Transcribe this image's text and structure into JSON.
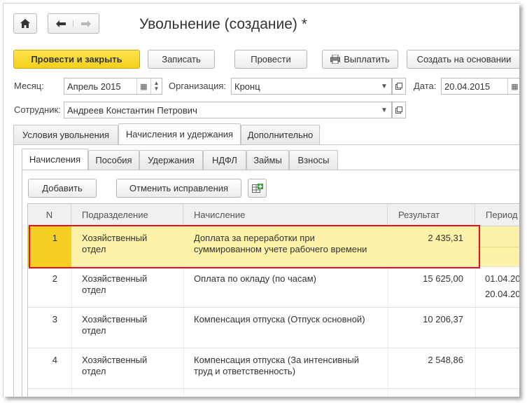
{
  "window": {
    "title": "Увольнение (создание) *"
  },
  "nav": {
    "home_icon": "home-icon",
    "back_icon": "arrow-left-icon",
    "forward_icon": "arrow-right-icon"
  },
  "toolbar": {
    "post_close": "Провести и закрыть",
    "save": "Записать",
    "post": "Провести",
    "pay": "Выплатить",
    "create_based": "Создать на основании"
  },
  "form": {
    "month_label": "Месяц:",
    "month_value": "Апрель 2015",
    "org_label": "Организация:",
    "org_value": "Кронц",
    "date_label": "Дата:",
    "date_value": "20.04.2015",
    "employee_label": "Сотрудник:",
    "employee_value": "Андреев Константин Петрович"
  },
  "tabs": [
    "Условия увольнения",
    "Начисления и удержания",
    "Дополнительно"
  ],
  "subtabs": [
    "Начисления",
    "Пособия",
    "Удержания",
    "НДФЛ",
    "Займы",
    "Взносы"
  ],
  "actions": {
    "add": "Добавить",
    "cancel_fix": "Отменить исправления"
  },
  "table": {
    "columns": [
      "N",
      "Подразделение",
      "Начисление",
      "Результат",
      "Период"
    ],
    "rows": [
      {
        "n": "1",
        "dept1": "Хозяйственный",
        "dept2": "отдел",
        "acc1": "Доплата за переработки при",
        "acc2": "суммированном учете рабочего времени",
        "result": "2 435,31",
        "p1": "",
        "p2": ""
      },
      {
        "n": "2",
        "dept1": "Хозяйственный",
        "dept2": "отдел",
        "acc1": "Оплата по окладу (по часам)",
        "acc2": "",
        "result": "15 625,00",
        "p1": "01.04.20",
        "p2": "20.04.20"
      },
      {
        "n": "3",
        "dept1": "Хозяйственный",
        "dept2": "отдел",
        "acc1": "Компенсация отпуска (Отпуск основной)",
        "acc2": "",
        "result": "10 206,37",
        "p1": "",
        "p2": ""
      },
      {
        "n": "4",
        "dept1": "Хозяйственный",
        "dept2": "отдел",
        "acc1": "Компенсация отпуска (За интенсивный",
        "acc2": "труд и ответственность)",
        "result": "2 548,86",
        "p1": "",
        "p2": ""
      }
    ]
  },
  "colors": {
    "accent_yellow": "#f4cf1c",
    "selected_row": "#fdf2a8",
    "highlight_border": "#e8101a"
  }
}
